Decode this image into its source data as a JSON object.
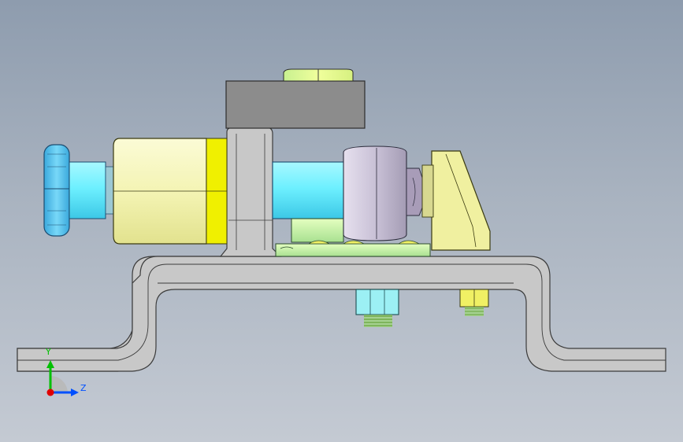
{
  "viewport": {
    "background_top": "#8e9cae",
    "background_bottom": "#c4cad3"
  },
  "model": {
    "parts": [
      "base-bracket",
      "clamp-block",
      "knurled-knob",
      "cylinder-body",
      "plunger-rod",
      "guide-bushing",
      "support-gusset",
      "hex-nut",
      "screws"
    ],
    "colors": {
      "bracket": "#c8c8c8",
      "knob": "#5ac8f0",
      "rod": "#6ef0ff",
      "cylinder": "#f4f4b4",
      "cylinder_band": "#f0f000",
      "block": "#8c8c8c",
      "gusset": "#f0f0a0",
      "bushing": "#c8c0d4",
      "green_part": "#c8f0a0",
      "screw": "#f0f064"
    }
  },
  "triad": {
    "y_label": "Y",
    "z_label": "Z",
    "y_color": "#00c000",
    "z_color": "#0050ff",
    "x_color": "#e00000"
  }
}
